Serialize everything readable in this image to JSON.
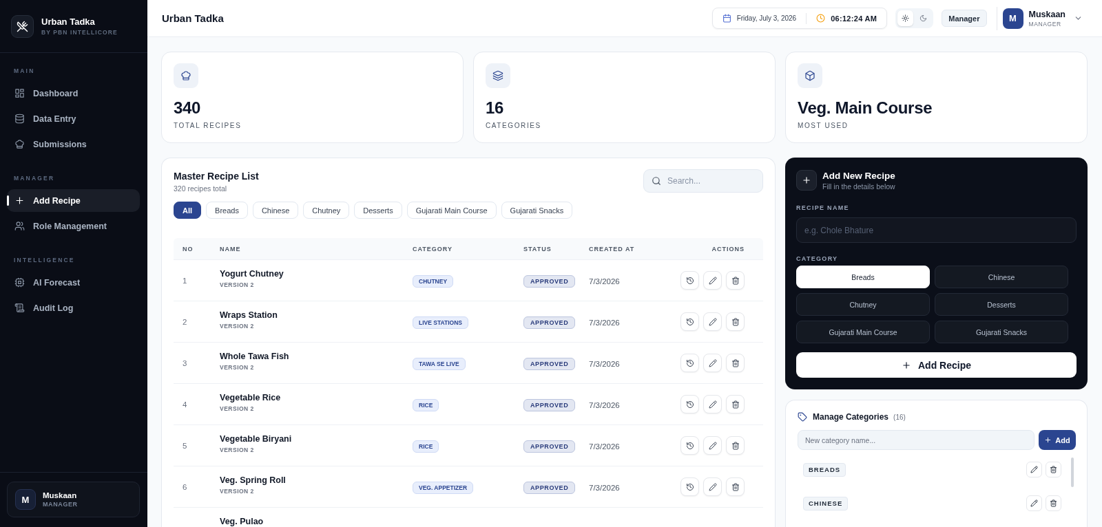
{
  "sidebar": {
    "brand": {
      "name": "Urban Tadka",
      "tagline": "BY PBN INTELLICORE"
    },
    "sections": [
      {
        "title": "MAIN",
        "items": [
          {
            "label": "Dashboard",
            "kind": "dashboard",
            "selected": false
          },
          {
            "label": "Data Entry",
            "kind": "data",
            "selected": false
          },
          {
            "label": "Submissions",
            "kind": "submissions",
            "selected": false
          }
        ]
      },
      {
        "title": "MANAGER",
        "items": [
          {
            "label": "Add Recipe",
            "kind": "add",
            "selected": true
          },
          {
            "label": "Role Management",
            "kind": "roles",
            "selected": false
          }
        ]
      },
      {
        "title": "INTELLIGENCE",
        "items": [
          {
            "label": "AI Forecast",
            "kind": "forecast",
            "selected": false
          },
          {
            "label": "Audit Log",
            "kind": "audit",
            "selected": false
          }
        ]
      }
    ],
    "user": {
      "initial": "M",
      "name": "Muskaan",
      "role": "MANAGER"
    }
  },
  "header": {
    "title": "Urban Tadka",
    "date": "Friday, July 3, 2026",
    "time": "06:12:24 AM",
    "theme_options": [
      {
        "kind": "light",
        "selected": true
      },
      {
        "kind": "dark",
        "selected": false
      }
    ],
    "role_button": "Manager",
    "user": {
      "initial": "M",
      "name": "Muskaan",
      "role": "MANAGER"
    }
  },
  "stats": [
    {
      "kind": "recipes",
      "value": "340",
      "label": "TOTAL RECIPES"
    },
    {
      "kind": "categories",
      "value": "16",
      "label": "CATEGORIES"
    },
    {
      "kind": "top",
      "value": "Veg. Main Course",
      "label": "MOST USED"
    }
  ],
  "recipe_list": {
    "title": "Master Recipe List",
    "subtitle": "320 recipes total",
    "search": {
      "placeholder": "Search..."
    },
    "filters": [
      {
        "label": "All",
        "selected": true
      },
      {
        "label": "Breads",
        "selected": false
      },
      {
        "label": "Chinese",
        "selected": false
      },
      {
        "label": "Chutney",
        "selected": false
      },
      {
        "label": "Desserts",
        "selected": false
      },
      {
        "label": "Gujarati Main Course",
        "selected": false
      },
      {
        "label": "Gujarati Snacks",
        "selected": false
      }
    ],
    "table": {
      "columns": [
        "NO",
        "NAME",
        "CATEGORY",
        "STATUS",
        "CREATED AT",
        "ACTIONS"
      ],
      "rows": [
        {
          "no": "1",
          "name": "Yogurt Chutney",
          "version": "VERSION 2",
          "category": "CHUTNEY",
          "status": "APPROVED",
          "created": "7/3/2026"
        },
        {
          "no": "2",
          "name": "Wraps Station",
          "version": "VERSION 2",
          "category": "LIVE STATIONS",
          "status": "APPROVED",
          "created": "7/3/2026"
        },
        {
          "no": "3",
          "name": "Whole Tawa Fish",
          "version": "VERSION 2",
          "category": "TAWA SE LIVE",
          "status": "APPROVED",
          "created": "7/3/2026"
        },
        {
          "no": "4",
          "name": "Vegetable Rice",
          "version": "VERSION 2",
          "category": "RICE",
          "status": "APPROVED",
          "created": "7/3/2026"
        },
        {
          "no": "5",
          "name": "Vegetable Biryani",
          "version": "VERSION 2",
          "category": "RICE",
          "status": "APPROVED",
          "created": "7/3/2026"
        },
        {
          "no": "6",
          "name": "Veg. Spring Roll",
          "version": "VERSION 2",
          "category": "VEG. APPETIZER",
          "status": "APPROVED",
          "created": "7/3/2026"
        },
        {
          "name": "Veg. Pulao"
        }
      ]
    }
  },
  "add_recipe": {
    "title": "Add New Recipe",
    "subtitle": "Fill in the details below",
    "name_label": "RECIPE NAME",
    "name_field": {
      "placeholder": "e.g. Chole Bhature"
    },
    "category_label": "CATEGORY",
    "categories": [
      {
        "label": "Breads",
        "selected": true
      },
      {
        "label": "Chinese",
        "selected": false
      },
      {
        "label": "Chutney",
        "selected": false
      },
      {
        "label": "Desserts",
        "selected": false
      },
      {
        "label": "Gujarati Main Course",
        "selected": false
      },
      {
        "label": "Gujarati Snacks",
        "selected": false
      }
    ],
    "submit": "Add Recipe"
  },
  "manage_categories": {
    "title": "Manage Categories",
    "count": "(16)",
    "field": {
      "placeholder": "New category name..."
    },
    "add_button": "Add",
    "items": [
      "BREADS",
      "CHINESE"
    ]
  }
}
